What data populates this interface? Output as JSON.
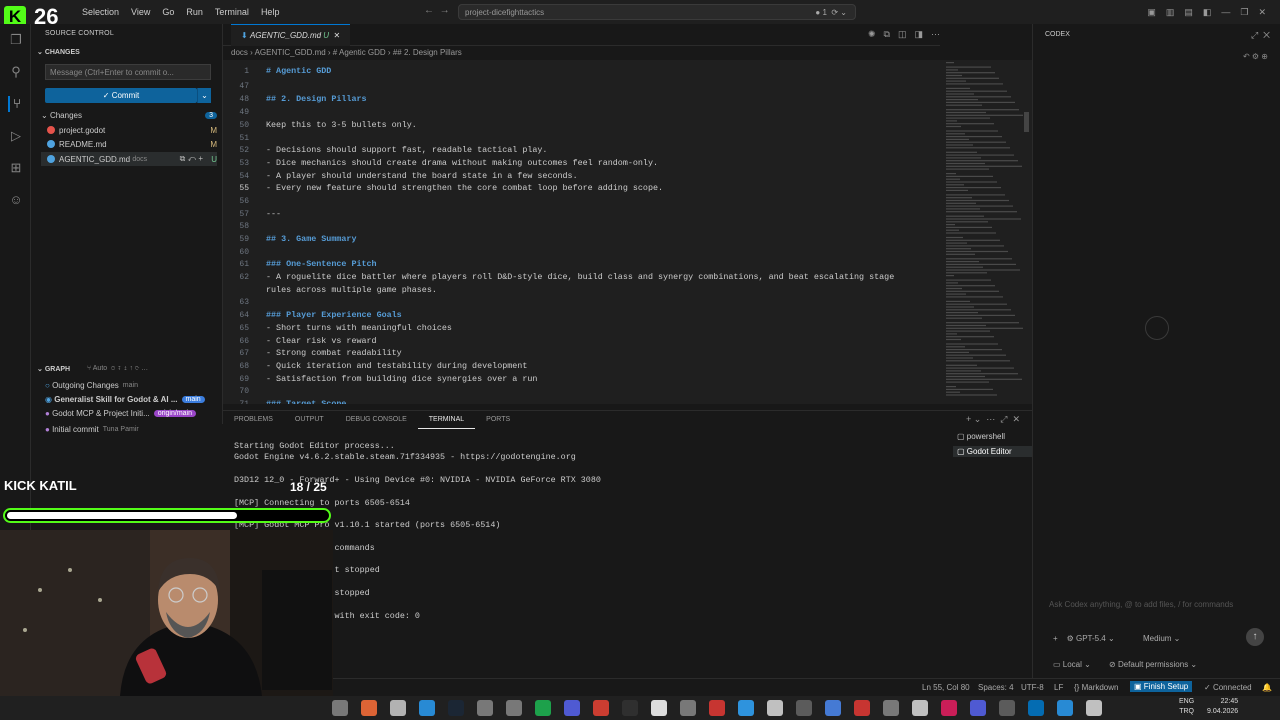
{
  "menu": [
    "Selection",
    "View",
    "Go",
    "Run",
    "Terminal",
    "Help"
  ],
  "logo_text": "26",
  "command_center": "project-dicefighttactics",
  "notif_count": "1",
  "sidebar": {
    "title": "SOURCE CONTROL",
    "changes_header": "CHANGES",
    "commit_placeholder": "Message (Ctrl+Enter to commit o...",
    "commit_label": "Commit",
    "changes_group": "Changes",
    "changes_count": "3",
    "files": [
      {
        "name": "project.godot",
        "status": "M"
      },
      {
        "name": "README.md",
        "status": "M"
      },
      {
        "name": "AGENTIC_GDD.md",
        "folder": "docs",
        "status": "U"
      }
    ],
    "graph_header": "GRAPH",
    "graph_auto": "Auto",
    "graph": [
      {
        "label": "Outgoing Changes",
        "sub": "main"
      },
      {
        "label": "Generalist Skill for Godot & AI ...",
        "tag": "main"
      },
      {
        "label": "Godot MCP & Project Initi...",
        "tag": "origin/main"
      },
      {
        "label": "Initial commit",
        "sub": "Tuna Pamir"
      }
    ]
  },
  "editor": {
    "tab_label": "AGENTIC_GDD.md",
    "tab_status": "U",
    "breadcrumb": "docs  ›  AGENTIC_GDD.md  ›  # Agentic GDD  ›  ## 2. Design Pillars",
    "lines": [
      {
        "n": "1",
        "t": "# Agentic GDD",
        "cls": "h"
      },
      {
        "n": "47",
        "t": ""
      },
      {
        "n": "48",
        "t": "## 2. Design Pillars",
        "cls": "h"
      },
      {
        "n": "49",
        "t": ""
      },
      {
        "n": "50",
        "t": "Keep this to 3-5 bullets only."
      },
      {
        "n": "51",
        "t": ""
      },
      {
        "n": "52",
        "t": "- Decisions should support fast, readable tactical play."
      },
      {
        "n": "53",
        "t": "- Dice mechanics should create drama without making outcomes feel random-only."
      },
      {
        "n": "54",
        "t": "- A player should understand the board state in a few seconds."
      },
      {
        "n": "55",
        "t": "- Every new feature should strengthen the core combat loop before adding scope."
      },
      {
        "n": "56",
        "t": ""
      },
      {
        "n": "57",
        "t": "---"
      },
      {
        "n": "58",
        "t": ""
      },
      {
        "n": "59",
        "t": "## 3. Game Summary",
        "cls": "h"
      },
      {
        "n": "60",
        "t": ""
      },
      {
        "n": "61",
        "t": "### One-Sentence Pitch",
        "cls": "h"
      },
      {
        "n": "62",
        "t": "- A roguelite dice battler where players roll D&D-style dice, build class and synergy combinations, and beat escalating stage"
      },
      {
        "n": "",
        "t": "rules across multiple game phases."
      },
      {
        "n": "63",
        "t": ""
      },
      {
        "n": "64",
        "t": "### Player Experience Goals",
        "cls": "h"
      },
      {
        "n": "65",
        "t": "- Short turns with meaningful choices"
      },
      {
        "n": "66",
        "t": "- Clear risk vs reward"
      },
      {
        "n": "67",
        "t": "- Strong combat readability"
      },
      {
        "n": "68",
        "t": "- Quick iteration and testability during development"
      },
      {
        "n": "69",
        "t": "- Satisfaction from building dice synergies over a run"
      },
      {
        "n": "70",
        "t": ""
      },
      {
        "n": "71",
        "t": "### Target Scope",
        "cls": "h"
      }
    ]
  },
  "codex": {
    "title": "CODEX",
    "placeholder": "Ask Codex anything, @ to add files, / for commands",
    "model": "GPT-5.4",
    "effort": "Medium",
    "location": "Local",
    "permissions": "Default permissions"
  },
  "panel": {
    "tabs": [
      "PROBLEMS",
      "OUTPUT",
      "DEBUG CONSOLE",
      "TERMINAL",
      "PORTS"
    ],
    "active_tab": "TERMINAL",
    "terminals": [
      "powershell",
      "Godot Editor"
    ],
    "lines": [
      "Starting Godot Editor process...",
      "Godot Engine v4.6.2.stable.steam.71f334935 - https://godotengine.org",
      "",
      "D3D12 12_0 - Forward+ - Using Device #0: NVIDIA - NVIDIA GeForce RTX 3080",
      "",
      "[MCP] Connecting to ports 6505-6514",
      "",
      "[MCP] Godot MCP Pro v1.10.1 started (ports 6505-6514)",
      "",
      "                    commands",
      "",
      "                    t stopped",
      "",
      "                    stopped",
      "",
      "                    with exit code: 0"
    ]
  },
  "status": {
    "position": "Ln 55, Col 80",
    "spaces": "Spaces: 4",
    "encoding": "UTF-8",
    "eol": "LF",
    "language": "Markdown",
    "finish": "Finish Setup",
    "connected": "Connected"
  },
  "overlay": {
    "kick_label": "KICK KATIL",
    "progress_text": "18 / 25",
    "progress": 0.72
  },
  "taskbar": {
    "lang": "ENG",
    "lang2": "TRQ",
    "time": "22:45",
    "date": "9.04.2026"
  }
}
